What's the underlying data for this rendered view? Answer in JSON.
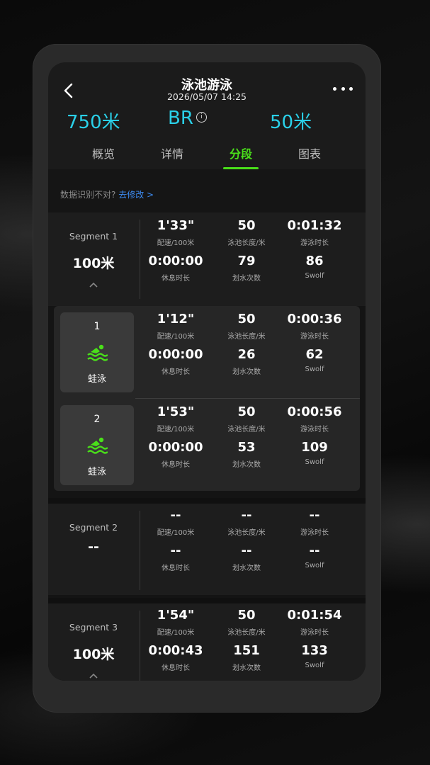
{
  "header": {
    "title": "泳池游泳",
    "datetime": "2026/05/07 14:25"
  },
  "summary": {
    "distance": "750米",
    "stroke": "BR",
    "info_glyph": "i",
    "pool_length": "50米"
  },
  "tabs": [
    {
      "label": "概览",
      "active": false
    },
    {
      "label": "详情",
      "active": false
    },
    {
      "label": "分段",
      "active": true
    },
    {
      "label": "图表",
      "active": false
    }
  ],
  "notice": {
    "text": "数据识别不对?",
    "link": "去修改 >"
  },
  "labels": {
    "pace": "配速/100米",
    "stroke_length": "泳池长度/米",
    "swim_time": "游泳时长",
    "rest_time": "休息时长",
    "stroke_count": "划水次数",
    "swolf": "Swolf"
  },
  "segments": [
    {
      "name": "Segment 1",
      "distance": "100米",
      "pace": "1'33\"",
      "pool": "50",
      "swim_time": "0:01:32",
      "rest": "0:00:00",
      "strokes": "79",
      "swolf": "86"
    },
    {
      "name": "Segment 2",
      "distance": "--",
      "pace": "--",
      "pool": "--",
      "swim_time": "--",
      "rest": "--",
      "strokes": "--",
      "swolf": "--"
    },
    {
      "name": "Segment 3",
      "distance": "100米",
      "pace": "1'54\"",
      "pool": "50",
      "swim_time": "0:01:54",
      "rest": "0:00:43",
      "strokes": "151",
      "swolf": "133"
    }
  ],
  "laps": [
    {
      "num": "1",
      "stroke": "蛙泳",
      "pace": "1'12\"",
      "pool": "50",
      "swim_time": "0:00:36",
      "rest": "0:00:00",
      "strokes": "26",
      "swolf": "62"
    },
    {
      "num": "2",
      "stroke": "蛙泳",
      "pace": "1'53\"",
      "pool": "50",
      "swim_time": "0:00:56",
      "rest": "0:00:00",
      "strokes": "53",
      "swolf": "109"
    }
  ],
  "colors": {
    "accent_green": "#4ae01a",
    "stat_cyan": "#2ad0e8",
    "link_blue": "#3d8bf0"
  },
  "icons": [
    "back-arrow-icon",
    "more-dots-icon",
    "info-icon",
    "chevron-up-icon",
    "swimmer-icon"
  ]
}
